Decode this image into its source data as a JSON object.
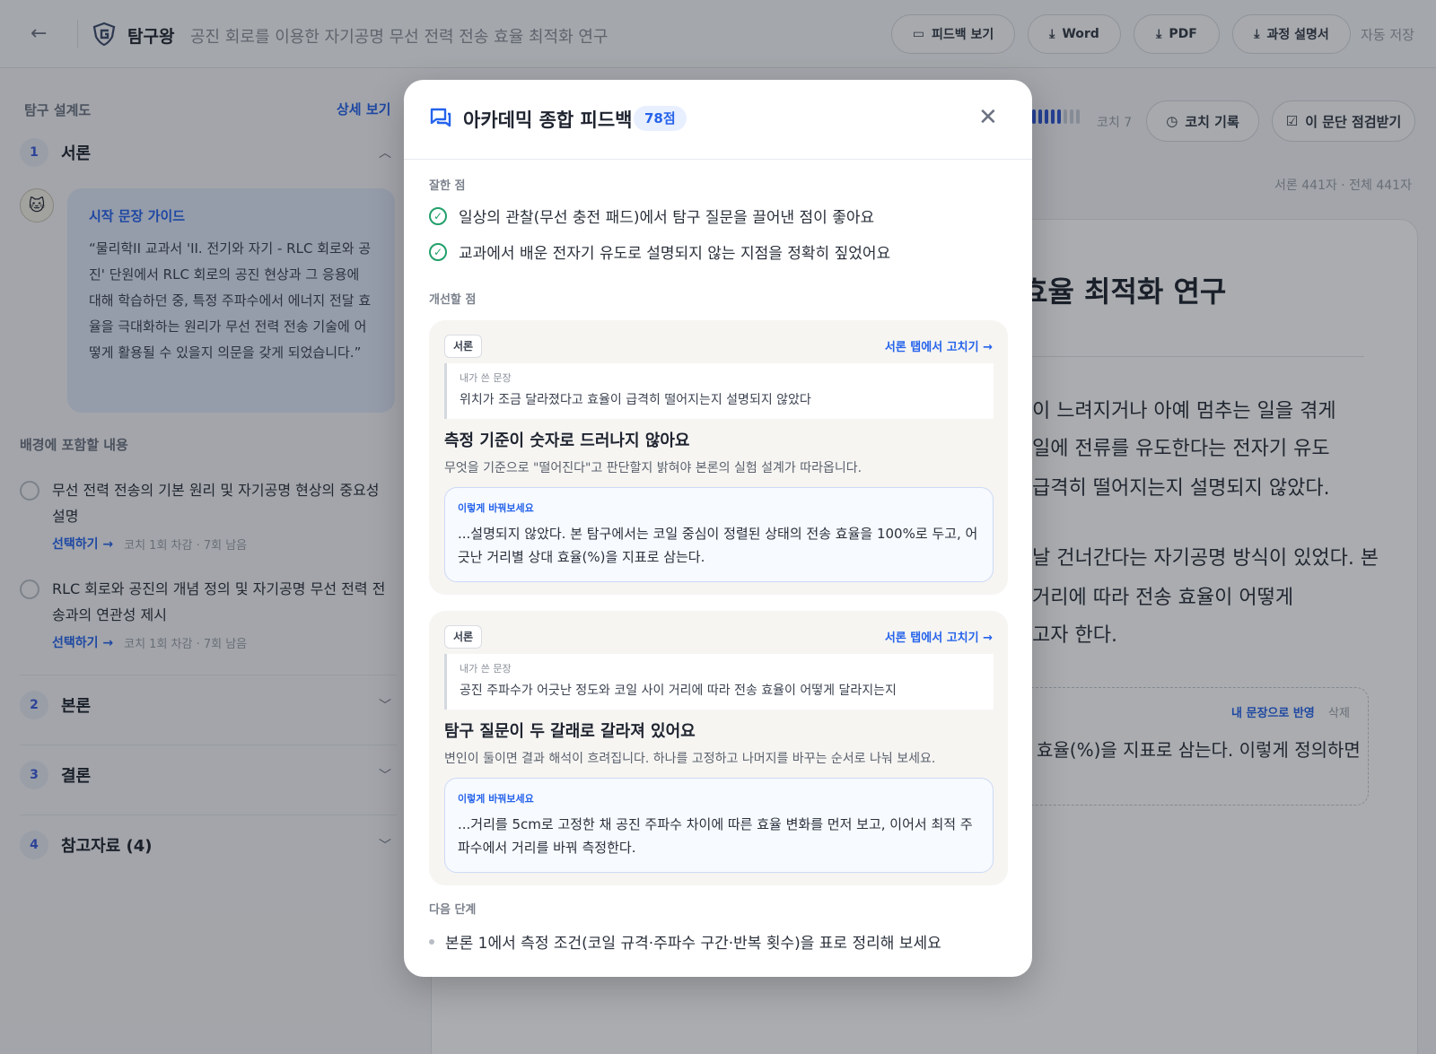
{
  "header": {
    "app_name": "탐구왕",
    "doc_title": "공진 회로를 이용한 자기공명 무선 전력 전송 효율 최적화 연구",
    "buttons": {
      "feedback": "피드백 보기",
      "word": "Word",
      "pdf": "PDF",
      "process": "과정 설명서"
    },
    "autosave": "자동 저장"
  },
  "sidebar": {
    "title": "탐구 설계도",
    "detail_link": "상세 보기",
    "sections": [
      {
        "num": "1",
        "label": "서론"
      },
      {
        "num": "2",
        "label": "본론"
      },
      {
        "num": "3",
        "label": "결론"
      },
      {
        "num": "4",
        "label": "참고자료 (4)"
      }
    ],
    "guide": {
      "heading": "시작 문장 가이드",
      "text": "“물리학II 교과서 'II. 전기와 자기 - RLC 회로와 공진' 단원에서 RLC 회로의 공진 현상과 그 응용에 대해 학습하던 중, 특정 주파수에서 에너지 전달 효율을 극대화하는 원리가 무선 전력 전송 기술에 어떻게 활용될 수 있을지 의문을 갖게 되었습니다.”"
    },
    "background_heading": "배경에 포함할 내용",
    "items": [
      {
        "text": "무선 전력 전송의 기본 원리 및 자기공명 현상의 중요성 설명",
        "link": "선택하기 →",
        "meta": "코치 1회 차감 · 7회 남음"
      },
      {
        "text": "RLC 회로와 공진의 개념 정의 및 자기공명 무선 전력 전송과의 연관성 제시",
        "link": "선택하기 →",
        "meta": "코치 1회 차감 · 7회 남음"
      }
    ]
  },
  "editor": {
    "coach_label": "코치 7",
    "coach_level": 5,
    "coach_max": 8,
    "coach_log": "코치 기록",
    "check_para": "이 문단 점검받기",
    "word_count": "서론 441자 · 전체 441자",
    "title_visible": "효율 최적화 연구",
    "lines": [
      "이 느려지거나 아예 멈추는 일을 겪게",
      "일에 전류를 유도한다는 전자기 유도",
      "급격히 떨어지는지 설명되지 않았다.",
      "날 건너간다는 자기공명 방식이 있었다. 본",
      "거리에 따라 전송 효율이 어떻게",
      "고자 한다."
    ],
    "reflect": "내 문장으로 반영",
    "delete": "삭제",
    "reflect_text": "효율(%)을 지표로 삼는다. 이렇게 정의하면"
  },
  "modal": {
    "title": "아카데믹 종합 피드백",
    "score": "78점",
    "good_heading": "잘한 점",
    "good": [
      "일상의 관찰(무선 충전 패드)에서 탐구 질문을 끌어낸 점이 좋아요",
      "교과에서 배운 전자기 유도로 설명되지 않는 지점을 정확히 짚었어요"
    ],
    "improve_heading": "개선할 점",
    "cards": [
      {
        "tag": "서론",
        "fix_link": "서론 탭에서 고치기 →",
        "mine_label": "내가 쓴 문장",
        "mine": "위치가 조금 달라졌다고 효율이 급격히 떨어지는지 설명되지 않았다",
        "heading": "측정 기준이 숫자로 드러나지 않아요",
        "desc": "무엇을 기준으로 \"떨어진다\"고 판단할지 밝혀야 본론의 실험 설계가 따라옵니다.",
        "sugg_label": "이렇게 바꿔보세요",
        "sugg": "...설명되지 않았다. 본 탐구에서는 코일 중심이 정렬된 상태의 전송 효율을 100%로 두고, 어긋난 거리별 상대 효율(%)을 지표로 삼는다."
      },
      {
        "tag": "서론",
        "fix_link": "서론 탭에서 고치기 →",
        "mine_label": "내가 쓴 문장",
        "mine": "공진 주파수가 어긋난 정도와 코일 사이 거리에 따라 전송 효율이 어떻게 달라지는지",
        "heading": "탐구 질문이 두 갈래로 갈라져 있어요",
        "desc": "변인이 둘이면 결과 해석이 흐려집니다. 하나를 고정하고 나머지를 바꾸는 순서로 나눠 보세요.",
        "sugg_label": "이렇게 바꿔보세요",
        "sugg": "...거리를 5cm로 고정한 채 공진 주파수 차이에 따른 효율 변화를 먼저 보고, 이어서 최적 주파수에서 거리를 바꿔 측정한다."
      }
    ],
    "next_heading": "다음 단계",
    "next": [
      "본론 1에서 측정 조건(코일 규격·주파수 구간·반복 횟수)을 표로 정리해 보세요"
    ]
  }
}
